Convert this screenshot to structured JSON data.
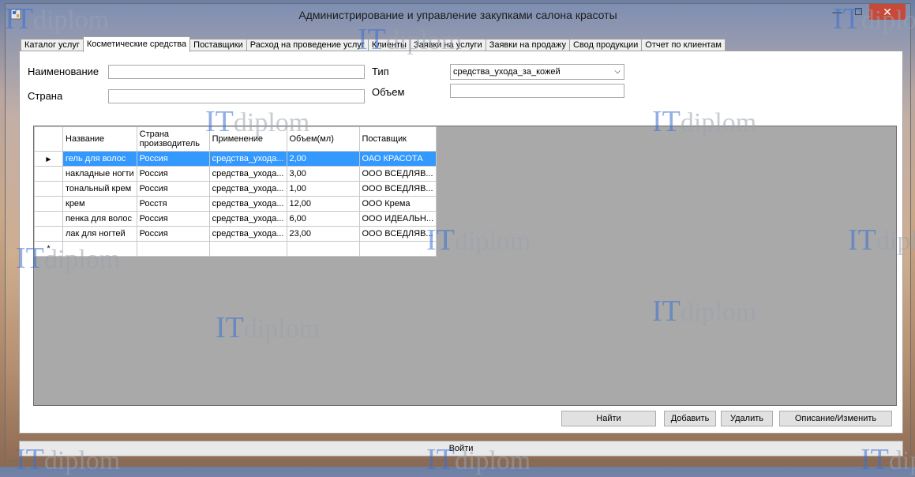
{
  "window": {
    "title": "Администрирование и управление закупками салона красоты"
  },
  "window_controls": {
    "minimize": "—",
    "maximize": "☐",
    "close": "✕"
  },
  "tabs": [
    {
      "label": "Каталог услуг"
    },
    {
      "label": "Косметические средства"
    },
    {
      "label": "Поставщики"
    },
    {
      "label": "Расход на проведение услуг"
    },
    {
      "label": "Клиенты"
    },
    {
      "label": "Заявки на услуги"
    },
    {
      "label": "Заявки на продажу"
    },
    {
      "label": "Свод продукции"
    },
    {
      "label": "Отчет по клиентам"
    }
  ],
  "form": {
    "name_label": "Наименование",
    "name_value": "",
    "country_label": "Страна",
    "country_value": "",
    "type_label": "Тип",
    "type_value": "средства_ухода_за_кожей",
    "volume_label": "Объем",
    "volume_value": ""
  },
  "grid": {
    "columns": [
      "Название",
      "Страна производитель",
      "Применение",
      "Объем(мл)",
      "Поставщик"
    ],
    "row_indicator": "▶",
    "new_row_indicator": "*",
    "rows": [
      [
        "гель для волос",
        "Россия",
        "средства_ухода...",
        "2,00",
        "ОАО КРАСОТА"
      ],
      [
        "накладные ногти",
        "Россия",
        "средства_ухода...",
        "3,00",
        "ООО ВСЕДЛЯВ..."
      ],
      [
        "тональный крем",
        "Россия",
        "средства_ухода...",
        "1,00",
        "ООО ВСЕДЛЯВ..."
      ],
      [
        "крем",
        "Росстя",
        "средства_ухода...",
        "12,00",
        "ООО Крема"
      ],
      [
        "пенка для волос",
        "Россия",
        "средства_ухода...",
        "6,00",
        "ООО ИДЕАЛЬН..."
      ],
      [
        "лак для ногтей",
        "Россия",
        "средства_ухода...",
        "23,00",
        "ООО ВСЕДЛЯВ..."
      ]
    ]
  },
  "buttons": {
    "find": "Найти",
    "add": "Добавить",
    "delete": "Удалить",
    "edit": "Описание/Изменить",
    "login": "Войти"
  },
  "watermark": {
    "it": "IT",
    "diplom": "diplom"
  },
  "colors": {
    "selection": "#3399ff",
    "grid_background": "#a9a9a9",
    "close_button": "#c7493a"
  }
}
